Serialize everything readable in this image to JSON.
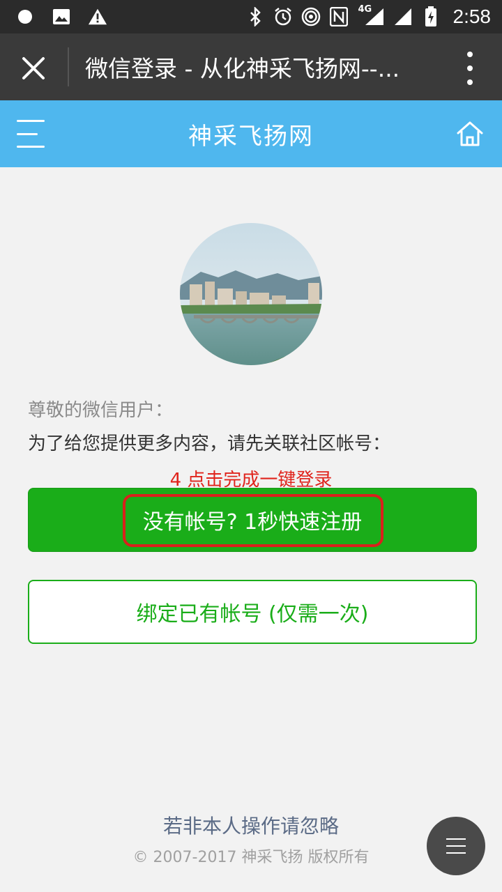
{
  "status_bar": {
    "time": "2:58",
    "network": "4G",
    "icons_left": [
      "circle-icon",
      "image-icon",
      "warning-icon"
    ],
    "icons_right": [
      "bluetooth-icon",
      "alarm-icon",
      "hotspot-icon",
      "nfc-icon",
      "signal-4g-icon",
      "signal-icon",
      "battery-charging-icon"
    ]
  },
  "browser": {
    "title": "微信登录 - 从化神采飞扬网--..."
  },
  "header": {
    "site_title": "神采飞扬网",
    "bg_color": "#4fb7ee"
  },
  "main": {
    "greeting": "尊敬的微信用户：",
    "description": "为了给您提供更多内容，请先关联社区帐号：",
    "hint": "4 点击完成一键登录",
    "register_label": "没有帐号? 1秒快速注册",
    "bind_label": "绑定已有帐号 (仅需一次)"
  },
  "footer": {
    "ignore_text": "若非本人操作请忽略",
    "copyright": "© 2007-2017 神采飞扬 版权所有"
  },
  "colors": {
    "accent_green": "#1aad19",
    "hint_red": "#e0241c"
  }
}
